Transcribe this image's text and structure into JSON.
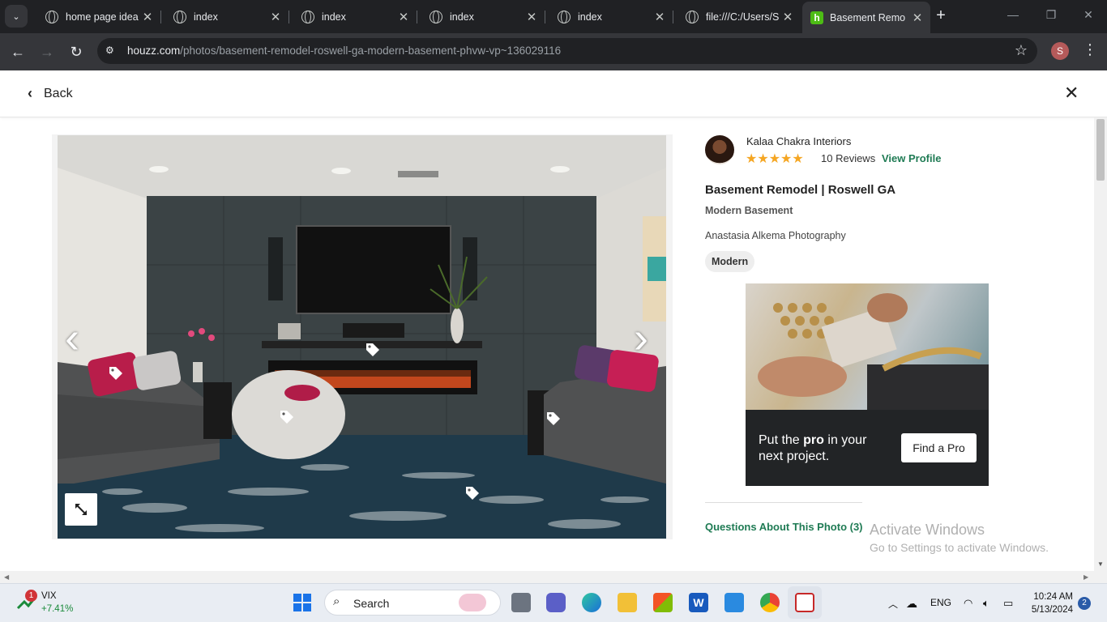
{
  "browser": {
    "tabs": [
      {
        "title": "home page idea"
      },
      {
        "title": "index"
      },
      {
        "title": "index"
      },
      {
        "title": "index"
      },
      {
        "title": "index"
      },
      {
        "title": "file:///C:/Users/S"
      },
      {
        "title": "Basement Remo"
      }
    ],
    "url_host": "houzz.com",
    "url_path": "/photos/basement-remodel-roswell-ga-modern-basement-phvw-vp~136029116",
    "profile_initial": "S"
  },
  "page": {
    "back_label": "Back",
    "pro": {
      "name": "Kalaa Chakra Interiors",
      "stars": "★★★★★",
      "reviews": "10 Reviews",
      "view_profile": "View Profile"
    },
    "photo_title": "Basement Remodel | Roswell GA",
    "category": "Modern Basement",
    "photographer": "Anastasia Alkema Photography",
    "style_tag": "Modern",
    "ad": {
      "cta_prefix": "Put the ",
      "cta_bold": "pro",
      "cta_suffix": " in your",
      "cta_line2": "next project.",
      "button": "Find a Pro"
    },
    "questions_link": "Questions About This Photo (3)"
  },
  "watermark": {
    "line1": "Activate Windows",
    "line2": "Go to Settings to activate Windows."
  },
  "taskbar": {
    "widget_badge": "1",
    "widget_name": "VIX",
    "widget_change": "+7.41%",
    "search_label": "Search",
    "lang": "ENG",
    "time": "10:24 AM",
    "date": "5/13/2024",
    "notifications": "2"
  },
  "colors": {
    "houzz_green": "#1f7b54",
    "star_gold": "#f5a623"
  }
}
